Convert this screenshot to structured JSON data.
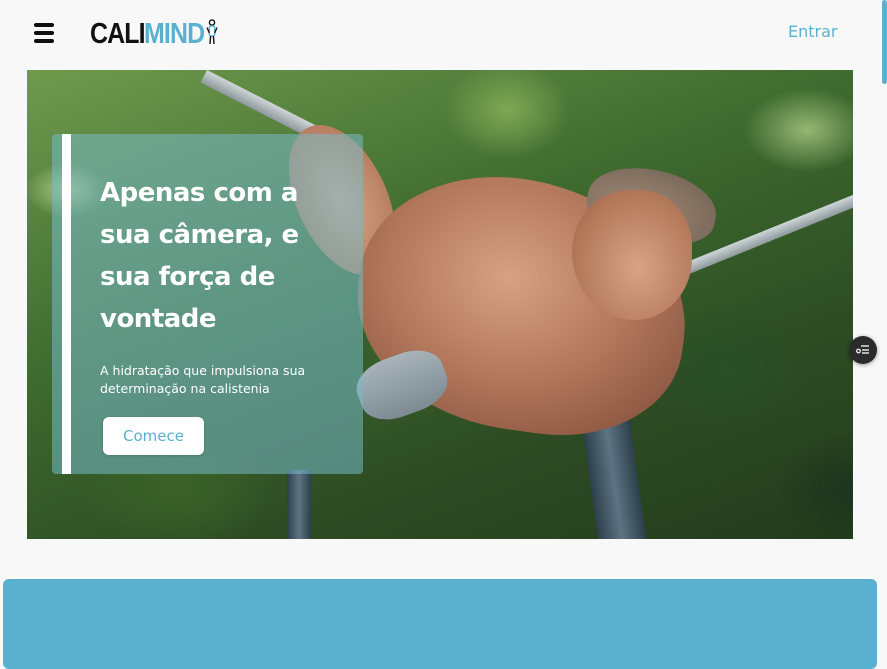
{
  "header": {
    "logo_part1": "CALI",
    "logo_part2": "MIND",
    "signin_label": "Entrar",
    "menu_icon": "hamburger-menu-icon",
    "logo_icon": "stick-figure-icon"
  },
  "hero": {
    "title": "Apenas com a sua câmera, e sua força de vontade",
    "subtitle": "A hidratação que impulsiona sua determinação na calistenia",
    "cta_label": "Comece",
    "image_subject": "athlete-hanging-on-bar"
  },
  "floating": {
    "icon": "list-filter-icon"
  },
  "colors": {
    "accent": "#5ab1cf",
    "text_dark": "#111111",
    "background": "#f8f8f8",
    "overlay": "rgba(120,185,200,0.55)"
  }
}
